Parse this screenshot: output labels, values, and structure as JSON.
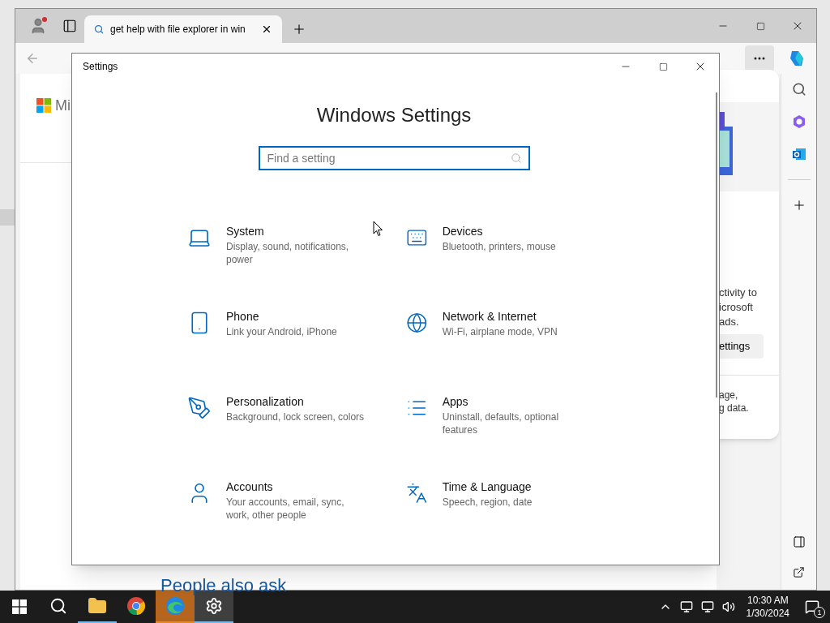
{
  "browser": {
    "tabs": [
      {
        "title": "get help with file explorer in win",
        "selected": true
      }
    ],
    "page": {
      "logo_text": "Mi",
      "heading": "People also ask"
    },
    "privacy_card": {
      "lines": [
        "ctivity to",
        "icrosoft",
        "ads."
      ],
      "button": "ettings",
      "footer_lines": [
        "age,",
        "g data."
      ]
    }
  },
  "settings": {
    "title": "Settings",
    "heading": "Windows Settings",
    "search": {
      "placeholder": "Find a setting"
    },
    "categories": [
      {
        "name": "System",
        "description": "Display, sound, notifications, power"
      },
      {
        "name": "Devices",
        "description": "Bluetooth, printers, mouse"
      },
      {
        "name": "Phone",
        "description": "Link your Android, iPhone"
      },
      {
        "name": "Network & Internet",
        "description": "Wi-Fi, airplane mode, VPN"
      },
      {
        "name": "Personalization",
        "description": "Background, lock screen, colors"
      },
      {
        "name": "Apps",
        "description": "Uninstall, defaults, optional features"
      },
      {
        "name": "Accounts",
        "description": "Your accounts, email, sync, work, other people"
      },
      {
        "name": "Time & Language",
        "description": "Speech, region, date"
      }
    ]
  },
  "taskbar": {
    "apps": [
      {
        "running": false,
        "attention": false,
        "selected": false
      },
      {
        "running": true,
        "attention": false,
        "selected": false
      },
      {
        "running": false,
        "attention": false,
        "selected": false
      },
      {
        "running": true,
        "attention": true,
        "selected": false
      },
      {
        "running": true,
        "attention": false,
        "selected": true
      }
    ],
    "time": "10:30 AM",
    "date": "1/30/2024",
    "notification_count": "1"
  }
}
